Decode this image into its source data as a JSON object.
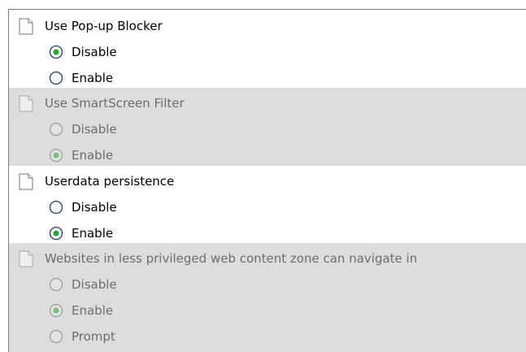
{
  "policies": [
    {
      "title": "Use Pop-up Blocker",
      "enabled_state": true,
      "options": [
        {
          "label": "Disable",
          "selected": true
        },
        {
          "label": "Enable",
          "selected": false
        }
      ]
    },
    {
      "title": "Use SmartScreen Filter",
      "enabled_state": false,
      "options": [
        {
          "label": "Disable",
          "selected": false
        },
        {
          "label": "Enable",
          "selected": true
        }
      ]
    },
    {
      "title": "Userdata persistence",
      "enabled_state": true,
      "options": [
        {
          "label": "Disable",
          "selected": false
        },
        {
          "label": "Enable",
          "selected": true
        }
      ]
    },
    {
      "title": "Websites in less privileged web content zone can navigate in",
      "enabled_state": false,
      "options": [
        {
          "label": "Disable",
          "selected": false
        },
        {
          "label": "Enable",
          "selected": true
        },
        {
          "label": "Prompt",
          "selected": false
        }
      ]
    }
  ],
  "colors": {
    "active_background": "#ffffff",
    "disabled_background": "#dddddd",
    "disabled_text": "#6d6d6d",
    "radio_selected_green": "#22a82f",
    "frame_border": "#7f7f7f"
  },
  "icons": {
    "policy": "document-icon",
    "option_unselected": "radio-unselected-icon",
    "option_selected": "radio-selected-icon"
  }
}
